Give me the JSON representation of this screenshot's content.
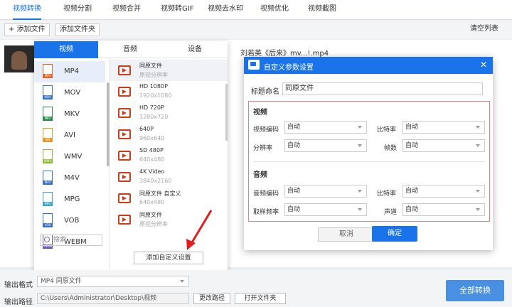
{
  "nav": {
    "tabs": [
      "视频转换",
      "视频分割",
      "视频合并",
      "视频转GIF",
      "视频去水印",
      "视频优化",
      "视频截图"
    ]
  },
  "toolbar": {
    "add_file": "+ 添加文件",
    "add_folder": "添加文件夹",
    "clear_list": "清空列表"
  },
  "file": {
    "name": "刘若英《后来》mv...!.mp4"
  },
  "format_panel": {
    "tabs": [
      "视频",
      "音频",
      "设备"
    ],
    "formats": [
      {
        "name": "MP4",
        "color": "#e0662c"
      },
      {
        "name": "MOV",
        "color": "#3a6fc4"
      },
      {
        "name": "MKV",
        "color": "#2a8a4a"
      },
      {
        "name": "AVI",
        "color": "#e39a2a"
      },
      {
        "name": "WMV",
        "color": "#8fb83a"
      },
      {
        "name": "M4V",
        "color": "#3a6fc4"
      },
      {
        "name": "MPG",
        "color": "#3aa4c4"
      },
      {
        "name": "VOB",
        "color": "#3a6fc4"
      },
      {
        "name": "WEBM",
        "color": "#6a4fb0"
      }
    ],
    "search_placeholder": "搜索",
    "presets": [
      {
        "title": "同原文件",
        "sub": "原视分辨率"
      },
      {
        "title": "HD 1080P",
        "sub": "1920x1080"
      },
      {
        "title": "HD 720P",
        "sub": "1280x720"
      },
      {
        "title": "640P",
        "sub": "960x640"
      },
      {
        "title": "SD 480P",
        "sub": "640x480"
      },
      {
        "title": "4K Video",
        "sub": "3840x2160"
      },
      {
        "title": "同原文件 自定义",
        "sub": "640x480"
      },
      {
        "title": "同原文件",
        "sub": "原视分辨率"
      }
    ],
    "add_custom": "添加自定义设置"
  },
  "dialog": {
    "title": "自定义参数设置",
    "title_label": "标题命名",
    "title_value": "同原文件",
    "video_header": "视频",
    "audio_header": "音频",
    "fields": {
      "video_codec": {
        "label": "视频编码",
        "value": "自动"
      },
      "bitrate_v": {
        "label": "比特率",
        "value": "自动"
      },
      "resolution": {
        "label": "分辨率",
        "value": "自动"
      },
      "framerate": {
        "label": "帧数",
        "value": "自动"
      },
      "audio_codec": {
        "label": "音频编码",
        "value": "自动"
      },
      "bitrate_a": {
        "label": "比特率",
        "value": "自动"
      },
      "samplerate": {
        "label": "取样频率",
        "value": "自动"
      },
      "channel": {
        "label": "声道",
        "value": "自动"
      }
    },
    "cancel": "取消",
    "ok": "确定"
  },
  "bottom": {
    "output_format_label": "输出格式",
    "output_format_value": "MP4  同原文件",
    "output_path_label": "输出路径",
    "output_path_value": "C:\\Users\\Administrator\\Desktop\\视频",
    "change_path": "更改路径",
    "open_folder": "打开文件夹",
    "convert_all": "全部转换"
  }
}
